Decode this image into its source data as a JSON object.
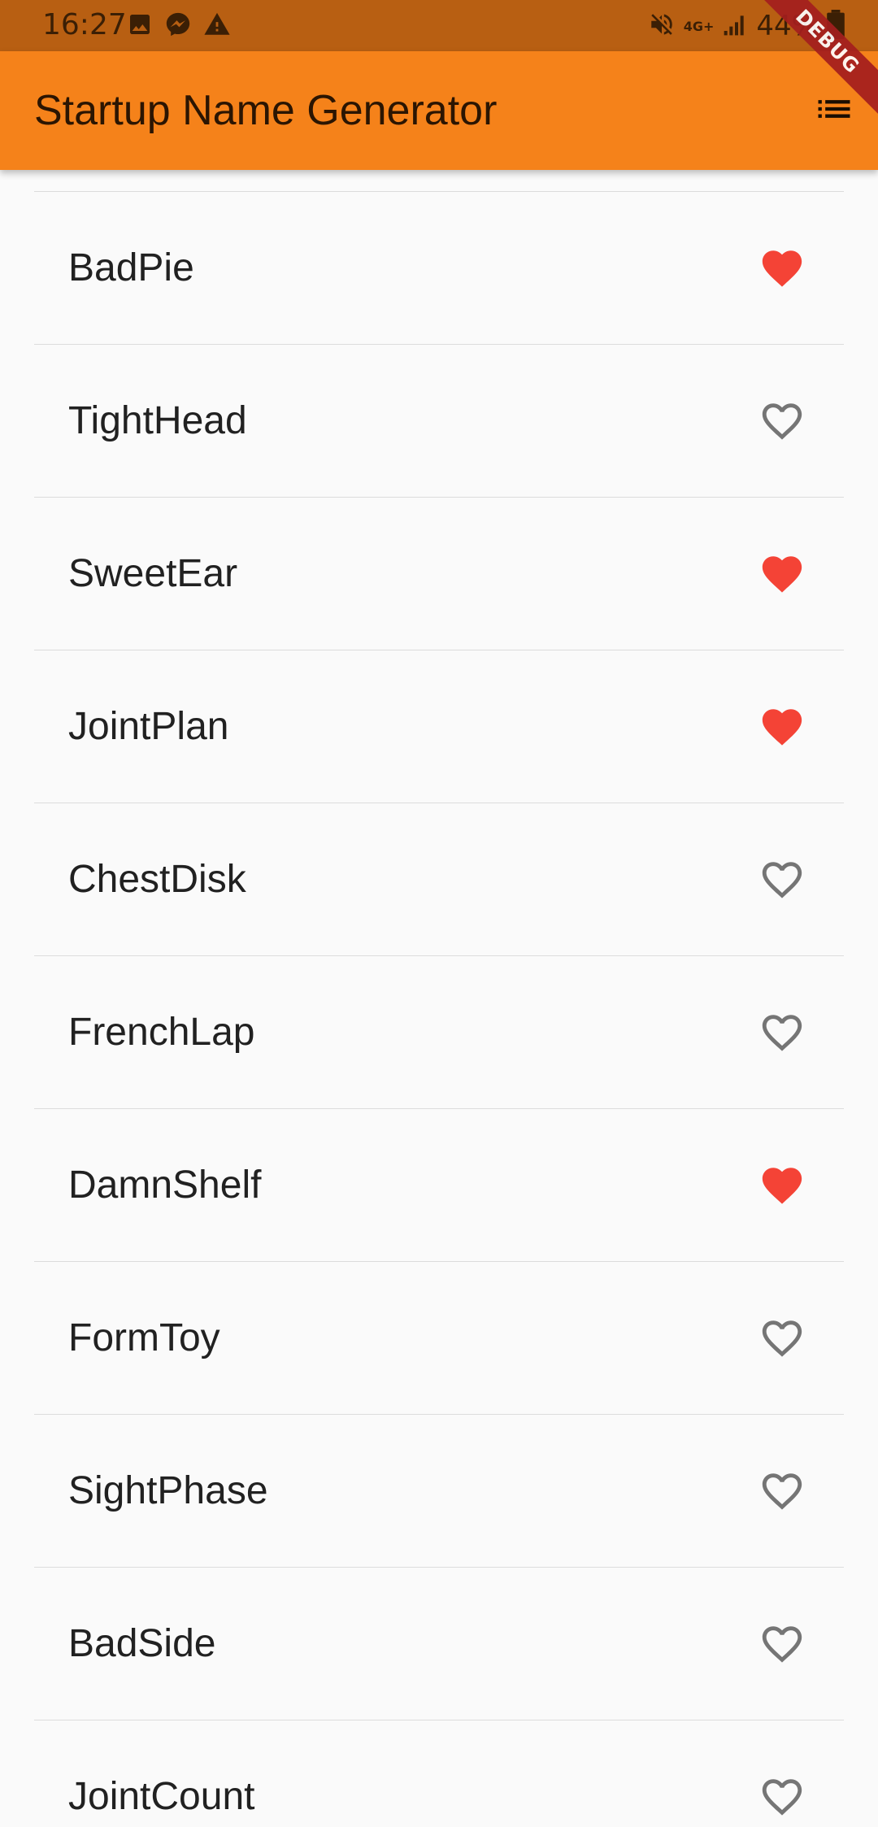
{
  "status_bar": {
    "time": "16:27",
    "battery": "44%",
    "network": "4G+"
  },
  "app_bar": {
    "title": "Startup Name Generator"
  },
  "debug_banner": "DEBUG",
  "colors": {
    "status_bar": "#b85f12",
    "app_bar": "#f5821a",
    "saved_heart": "#f44336",
    "unsaved_heart": "#757575"
  },
  "list": {
    "items": [
      {
        "name": "BadPie",
        "saved": true
      },
      {
        "name": "TightHead",
        "saved": false
      },
      {
        "name": "SweetEar",
        "saved": true
      },
      {
        "name": "JointPlan",
        "saved": true
      },
      {
        "name": "ChestDisk",
        "saved": false
      },
      {
        "name": "FrenchLap",
        "saved": false
      },
      {
        "name": "DamnShelf",
        "saved": true
      },
      {
        "name": "FormToy",
        "saved": false
      },
      {
        "name": "SightPhase",
        "saved": false
      },
      {
        "name": "BadSide",
        "saved": false
      },
      {
        "name": "JointCount",
        "saved": false
      }
    ]
  }
}
